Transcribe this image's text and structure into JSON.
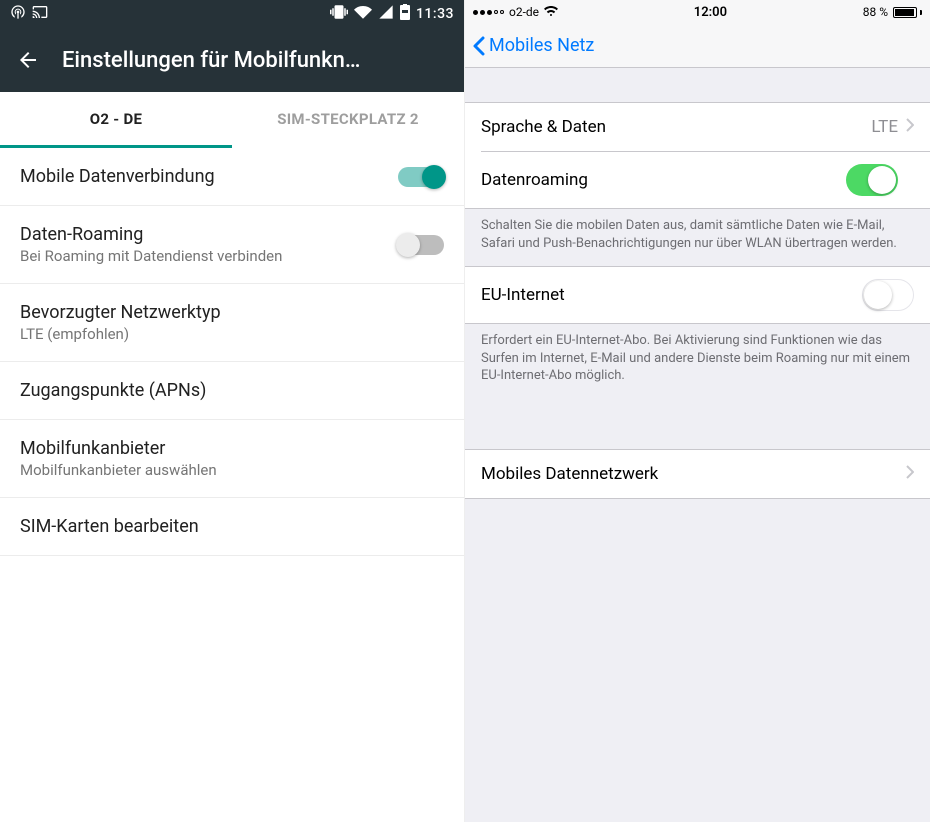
{
  "android": {
    "status": {
      "time": "11:33"
    },
    "header": {
      "title": "Einstellungen für Mobilfunkn…"
    },
    "tabs": {
      "tab1": "O2 - DE",
      "tab2": "SIM-STECKPLATZ 2"
    },
    "items": {
      "mobile_data": {
        "title": "Mobile Datenverbindung"
      },
      "roaming": {
        "title": "Daten-Roaming",
        "sub": "Bei Roaming mit Datendienst verbinden"
      },
      "network_type": {
        "title": "Bevorzugter Netzwerktyp",
        "sub": "LTE (empfohlen)"
      },
      "apn": {
        "title": "Zugangspunkte (APNs)"
      },
      "carrier": {
        "title": "Mobilfunkanbieter",
        "sub": "Mobilfunkanbieter auswählen"
      },
      "sim_edit": {
        "title": "SIM-Karten bearbeiten"
      }
    }
  },
  "ios": {
    "status": {
      "carrier": "o2-de",
      "time": "12:00",
      "battery": "88 %"
    },
    "nav": {
      "back": "Mobiles Netz"
    },
    "rows": {
      "voice_data": {
        "label": "Sprache & Daten",
        "value": "LTE"
      },
      "roaming": {
        "label": "Datenroaming"
      },
      "eu_internet": {
        "label": "EU-Internet"
      },
      "data_network": {
        "label": "Mobiles Datennetzwerk"
      }
    },
    "footers": {
      "roaming": "Schalten Sie die mobilen Daten aus, damit sämtliche Daten wie E-Mail, Safari und Push-Benachrichtigungen nur über WLAN übertragen werden.",
      "eu": "Erfordert ein EU-Internet-Abo. Bei Aktivierung sind Funktionen wie das Surfen im Internet, E-Mail und andere Dienste beim Roaming nur mit einem EU-Internet-Abo möglich."
    }
  }
}
